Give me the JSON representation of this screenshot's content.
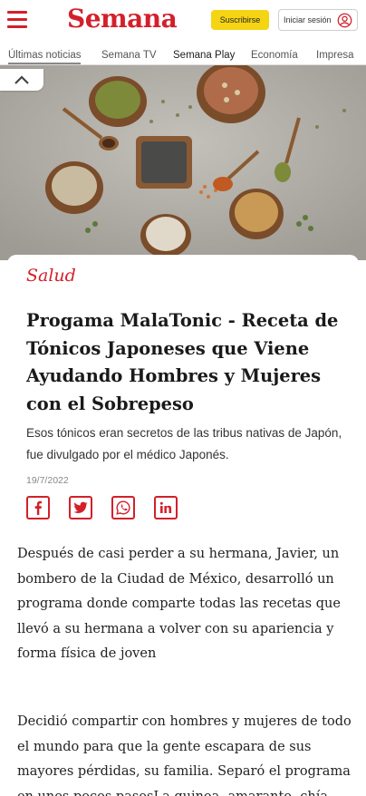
{
  "header": {
    "logo": "Semana",
    "subscribe_label": "Suscribirse",
    "login_label": "Iniciar sesión"
  },
  "nav": {
    "items": [
      "Últimas noticias",
      "Semana TV",
      "Semana Play",
      "Economía",
      "Impresa"
    ]
  },
  "article": {
    "section": "Salud",
    "headline": "Progama MalaTonic - Receta de Tónicos Japoneses que Viene Ayudando Hombres y Mujeres con el Sobrepeso",
    "summary": "Esos tónicos eran secretos de las tribus nativas de Japón, fue divulgado por el médico Japonés.",
    "date": "19/7/2022",
    "paragraphs": [
      "Después de casi perder a su hermana, Javier, un bombero de la Ciudad de México, desarrolló un programa donde comparte todas las recetas que llevó a su hermana a volver con su apariencia y forma física de joven",
      "Decidió compartir con hombres y mujeres de todo el mundo para que la gente escapara de sus mayores pérdidas, su familia. Separó el programa en unos pocos pasosLa quinoa, amaranto, chía, linaza, son semillas"
    ]
  },
  "share": [
    "facebook-icon",
    "twitter-icon",
    "whatsapp-icon",
    "linkedin-icon"
  ],
  "colors": {
    "brand": "#d3202a",
    "subscribe_bg": "#f5d414"
  }
}
